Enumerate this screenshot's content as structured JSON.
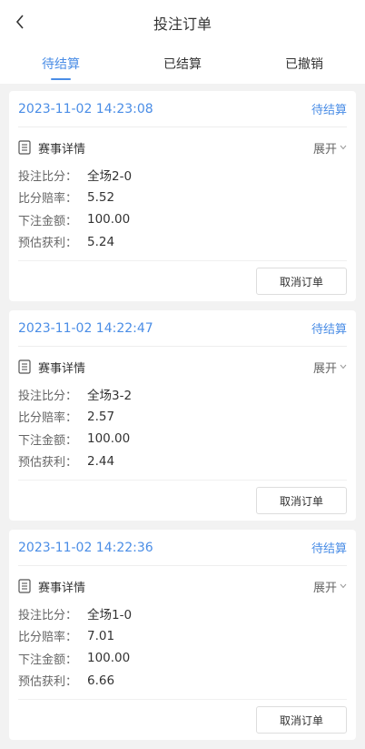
{
  "header": {
    "title": "投注订单",
    "back_icon": "chevron-left-icon"
  },
  "tabs": [
    {
      "label": "待结算",
      "active": true
    },
    {
      "label": "已结算",
      "active": false
    },
    {
      "label": "已撤销",
      "active": false
    }
  ],
  "accent_color": "#4a8de6",
  "orders": [
    {
      "time": "2023-11-02 14:23:08",
      "status": "待结算",
      "detail_title": "赛事详情",
      "expand_label": "展开",
      "rows": [
        {
          "label": "投注比分：",
          "value": "全场2-0"
        },
        {
          "label": "比分赔率：",
          "value": "5.52"
        },
        {
          "label": "下注金额：",
          "value": "100.00"
        },
        {
          "label": "预估获利：",
          "value": "5.24"
        }
      ],
      "cancel_label": "取消订单"
    },
    {
      "time": "2023-11-02 14:22:47",
      "status": "待结算",
      "detail_title": "赛事详情",
      "expand_label": "展开",
      "rows": [
        {
          "label": "投注比分：",
          "value": "全场3-2"
        },
        {
          "label": "比分赔率：",
          "value": "2.57"
        },
        {
          "label": "下注金额：",
          "value": "100.00"
        },
        {
          "label": "预估获利：",
          "value": "2.44"
        }
      ],
      "cancel_label": "取消订单"
    },
    {
      "time": "2023-11-02 14:22:36",
      "status": "待结算",
      "detail_title": "赛事详情",
      "expand_label": "展开",
      "rows": [
        {
          "label": "投注比分：",
          "value": "全场1-0"
        },
        {
          "label": "比分赔率：",
          "value": "7.01"
        },
        {
          "label": "下注金额：",
          "value": "100.00"
        },
        {
          "label": "预估获利：",
          "value": "6.66"
        }
      ],
      "cancel_label": "取消订单"
    }
  ]
}
